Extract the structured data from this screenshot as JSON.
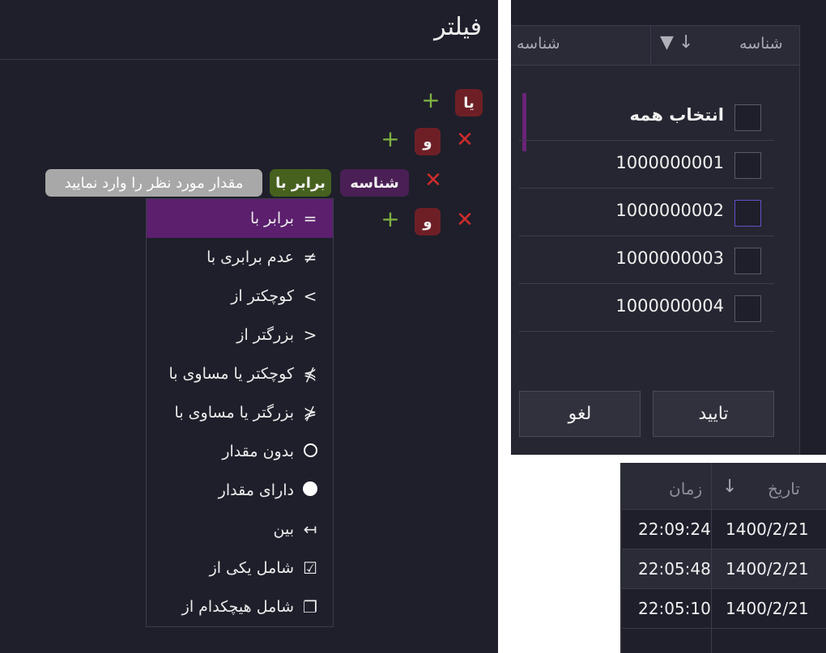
{
  "filter": {
    "title": "فیلتر",
    "or_label": "یا",
    "and_label": "و",
    "field_label": "شناسه",
    "operator_label": "برابر با",
    "value_placeholder": "مقدار مورد نظر را وارد نمایید",
    "add_icon": "+",
    "remove_icon": "✕"
  },
  "operators": [
    {
      "symbol": "=",
      "label": "برابر با",
      "selected": true
    },
    {
      "symbol": "≠",
      "label": "عدم برابری با"
    },
    {
      "symbol": ">",
      "label": "کوچکتر از"
    },
    {
      "symbol": "<",
      "label": "بزرگتر از"
    },
    {
      "symbol": "⋡",
      "label": "کوچکتر یا مساوی با"
    },
    {
      "symbol": "⋠",
      "label": "بزرگتر یا مساوی با"
    },
    {
      "symbol": "",
      "label": "بدون مقدار",
      "icon": "circle-outline-icon"
    },
    {
      "symbol": "",
      "label": "دارای مقدار",
      "icon": "circle-filled-icon"
    },
    {
      "symbol": "↤",
      "label": "بین"
    },
    {
      "symbol": "☑",
      "label": "شامل یکی از"
    },
    {
      "symbol": "❐",
      "label": "شامل هیچکدام از"
    }
  ],
  "grid": {
    "col1_header": "شناسه",
    "col2_header": "شناسه",
    "select_all": "انتخاب همه",
    "items": [
      "1000000001",
      "1000000002",
      "1000000003",
      "1000000004"
    ],
    "confirm": "تایید",
    "cancel": "لغو",
    "sort_icon": "↓",
    "filter_icon": "▼"
  },
  "table": {
    "date_header": "تاریخ",
    "time_header": "زمان",
    "sort_icon": "↓",
    "rows": [
      {
        "date": "1400/2/21",
        "time": "22:09:24"
      },
      {
        "date": "1400/2/21",
        "time": "22:05:48"
      },
      {
        "date": "1400/2/21",
        "time": "22:05:10"
      }
    ]
  }
}
